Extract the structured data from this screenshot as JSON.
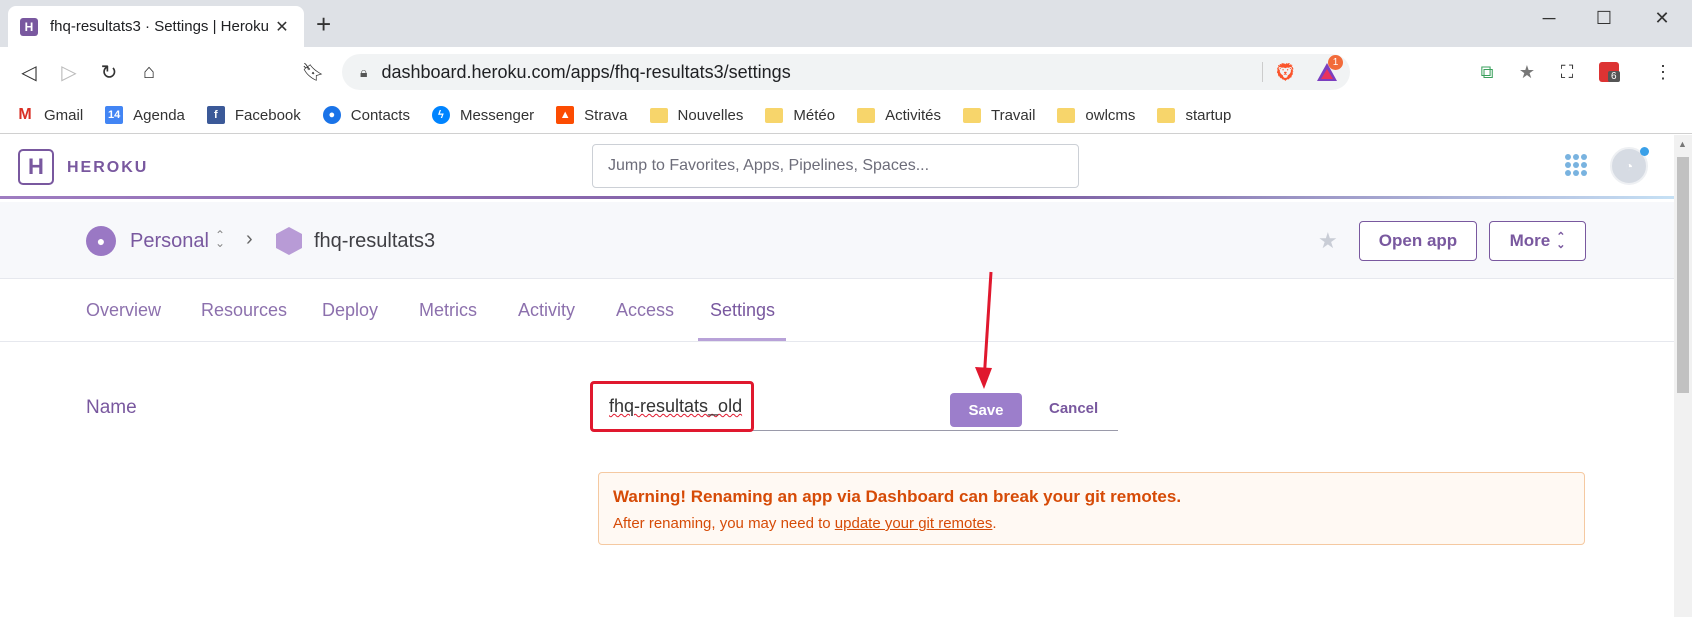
{
  "browser": {
    "tab_title": "fhq-resultats3 · Settings | Heroku",
    "url": "dashboard.heroku.com/apps/fhq-resultats3/settings",
    "ext_badge_count": "1",
    "ext_badge_count2": "6",
    "bookmarks": [
      {
        "label": "Gmail",
        "icon": "gmail-icon"
      },
      {
        "label": "Agenda",
        "icon": "calendar-icon"
      },
      {
        "label": "Facebook",
        "icon": "facebook-icon"
      },
      {
        "label": "Contacts",
        "icon": "contacts-icon"
      },
      {
        "label": "Messenger",
        "icon": "messenger-icon"
      },
      {
        "label": "Strava",
        "icon": "strava-icon"
      },
      {
        "label": "Nouvelles",
        "icon": "folder-icon"
      },
      {
        "label": "Météo",
        "icon": "folder-icon"
      },
      {
        "label": "Activités",
        "icon": "folder-icon"
      },
      {
        "label": "Travail",
        "icon": "folder-icon"
      },
      {
        "label": "owlcms",
        "icon": "folder-icon"
      },
      {
        "label": "startup",
        "icon": "folder-icon"
      }
    ]
  },
  "header": {
    "brand": "HEROKU",
    "search_placeholder": "Jump to Favorites, Apps, Pipelines, Spaces..."
  },
  "app_bar": {
    "account": "Personal",
    "app_name": "fhq-resultats3",
    "open_app_label": "Open app",
    "more_label": "More"
  },
  "tabs": [
    "Overview",
    "Resources",
    "Deploy",
    "Metrics",
    "Activity",
    "Access",
    "Settings"
  ],
  "active_tab": "Settings",
  "settings": {
    "name_label": "Name",
    "name_value": "fhq-resultats_old",
    "save_label": "Save",
    "cancel_label": "Cancel",
    "warning_title": "Warning! Renaming an app via Dashboard can break your git remotes.",
    "warning_prefix": "After renaming, you may need to ",
    "warning_link": "update your git remotes",
    "warning_suffix": "."
  },
  "colors": {
    "brand": "#79589f",
    "warning": "#d64b07",
    "highlight": "#e0182e"
  }
}
